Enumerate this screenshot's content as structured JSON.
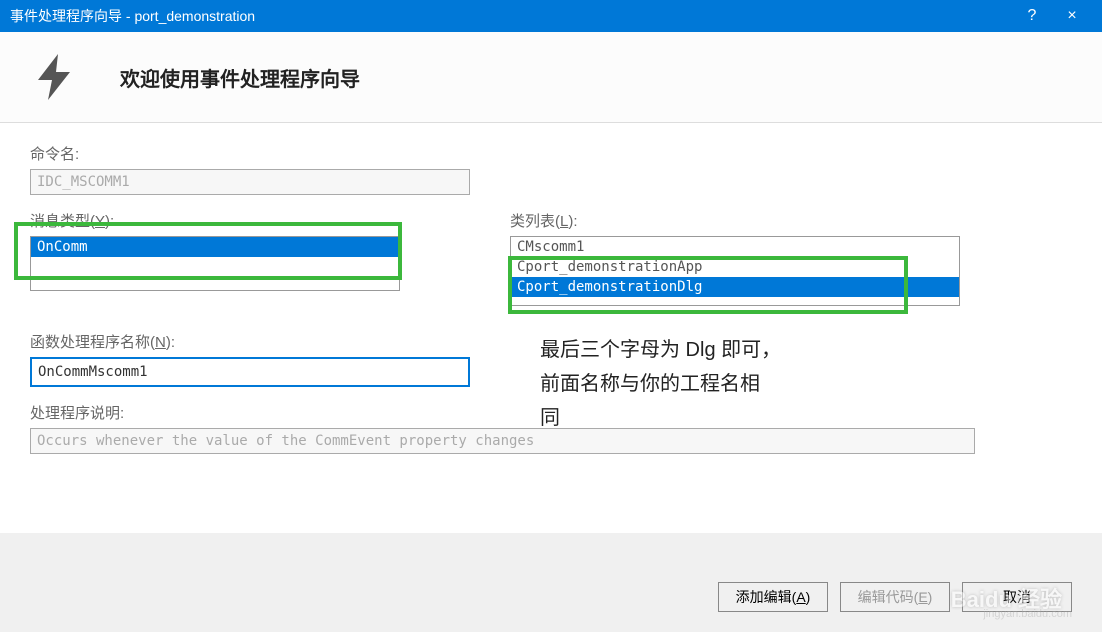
{
  "titlebar": {
    "title": "事件处理程序向导 - port_demonstration",
    "help": "?",
    "close": "×"
  },
  "header": {
    "title": "欢迎使用事件处理程序向导"
  },
  "commandName": {
    "label": "命令名:",
    "value": "IDC_MSCOMM1"
  },
  "messageType": {
    "label_prefix": "消息类型(",
    "label_key": "Y",
    "label_suffix": "):",
    "items": [
      "OnComm"
    ],
    "selected": 0
  },
  "classList": {
    "label_prefix": "类列表(",
    "label_key": "L",
    "label_suffix": "):",
    "items": [
      "CMscomm1",
      "Cport_demonstrationApp",
      "Cport_demonstrationDlg"
    ],
    "selected": 2
  },
  "handlerName": {
    "label_prefix": "函数处理程序名称(",
    "label_key": "N",
    "label_suffix": "):",
    "value": "OnCommMscomm1"
  },
  "handlerDesc": {
    "label": "处理程序说明:",
    "value": "Occurs whenever the value of the CommEvent property changes"
  },
  "annotation": {
    "line1": "最后三个字母为 Dlg 即可，",
    "line2": "前面名称与你的工程名相",
    "line3": "同"
  },
  "footer": {
    "addEdit_prefix": "添加编辑(",
    "addEdit_key": "A",
    "addEdit_suffix": ")",
    "editCode_prefix": "编辑代码(",
    "editCode_key": "E",
    "editCode_suffix": ")",
    "cancel": "取消"
  },
  "watermark": {
    "brand": "Baidu 经验",
    "url": "jingyan.baidu.com"
  }
}
